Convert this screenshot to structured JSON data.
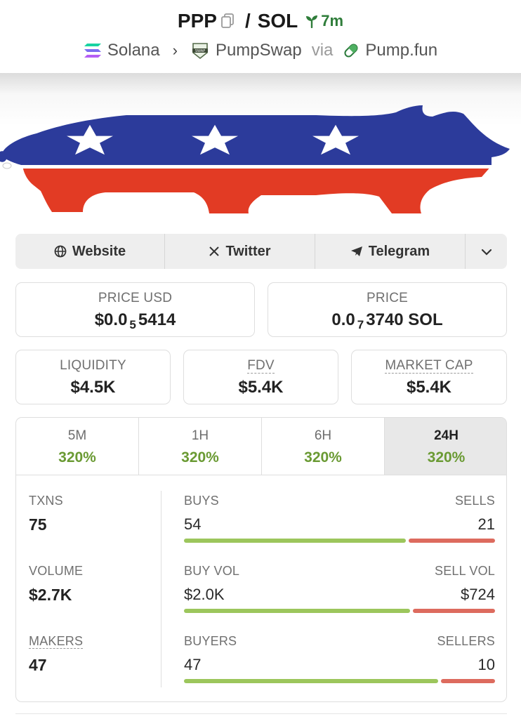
{
  "header": {
    "base_symbol": "PPP",
    "separator": "/",
    "quote_symbol": "SOL",
    "age": "7m",
    "breadcrumb": {
      "chain": "Solana",
      "dex": "PumpSwap",
      "via": "via",
      "launchpad": "Pump.fun"
    }
  },
  "banner": {
    "image": "red-white-blue-pig-banner"
  },
  "links": {
    "website": "Website",
    "twitter": "Twitter",
    "telegram": "Telegram"
  },
  "prices": {
    "price_usd_label": "PRICE USD",
    "price_usd_prefix": "$0.0",
    "price_usd_zeros": "5",
    "price_usd_digits": "5414",
    "price_label": "PRICE",
    "price_prefix": "0.0",
    "price_zeros": "7",
    "price_digits": "3740 SOL"
  },
  "metrics": {
    "liquidity_label": "LIQUIDITY",
    "liquidity_value": "$4.5K",
    "fdv_label": "FDV",
    "fdv_value": "$5.4K",
    "mcap_label": "MARKET CAP",
    "mcap_value": "$5.4K"
  },
  "timeframes": [
    {
      "label": "5M",
      "change": "320%"
    },
    {
      "label": "1H",
      "change": "320%"
    },
    {
      "label": "6H",
      "change": "320%"
    },
    {
      "label": "24H",
      "change": "320%"
    }
  ],
  "active_timeframe": "24H",
  "stats": {
    "txns_label": "TXNS",
    "txns_value": "75",
    "buys_label": "BUYS",
    "buys_value": "54",
    "sells_label": "SELLS",
    "sells_value": "21",
    "volume_label": "VOLUME",
    "volume_value": "$2.7K",
    "buy_vol_label": "BUY VOL",
    "buy_vol_value": "$2.0K",
    "sell_vol_label": "SELL VOL",
    "sell_vol_value": "$724",
    "makers_label": "MAKERS",
    "makers_value": "47",
    "buyers_label": "BUYERS",
    "buyers_value": "47",
    "sellers_label": "SELLERS",
    "sellers_value": "10"
  },
  "colors": {
    "positive": "#6a9a33",
    "buy_bar": "#9cc65c",
    "sell_bar": "#dd6b5e",
    "age_green": "#2f7d3a"
  }
}
